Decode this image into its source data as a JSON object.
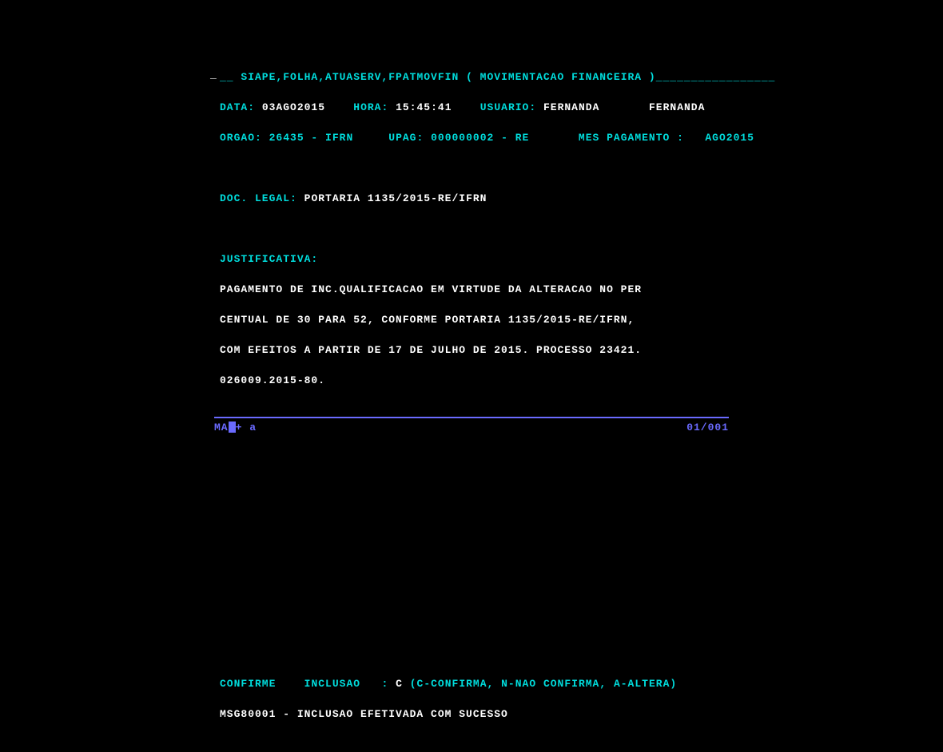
{
  "header": {
    "path": "SIAPE,FOLHA,ATUASERV,FPATMOVFIN",
    "title": "( MOVIMENTACAO FINANCEIRA )"
  },
  "row2": {
    "data_label": "DATA:",
    "data_value": "03AGO2015",
    "hora_label": "HORA:",
    "hora_value": "15:45:41",
    "usuario_label": "USUARIO:",
    "usuario_value": "FERNANDA",
    "usuario_extra": "FERNANDA"
  },
  "row3": {
    "orgao_label": "ORGAO:",
    "orgao_value": "26435 - IFRN",
    "upag_label": "UPAG:",
    "upag_value": "000000002 - RE",
    "mes_label": "MES PAGAMENTO :",
    "mes_value": "AGO2015"
  },
  "doc": {
    "label": "DOC. LEGAL:",
    "value": "PORTARIA 1135/2015-RE/IFRN"
  },
  "justificativa": {
    "label": "JUSTIFICATIVA:",
    "l1": "PAGAMENTO DE INC.QUALIFICACAO EM VIRTUDE DA ALTERACAO NO PER",
    "l2": "CENTUAL DE 30 PARA 52, CONFORME PORTARIA 1135/2015-RE/IFRN,",
    "l3": "COM EFEITOS A PARTIR DE 17 DE JULHO DE 2015. PROCESSO 23421.",
    "l4": "026009.2015-80."
  },
  "confirm": {
    "label1": "CONFIRME",
    "label2": "INCLUSAO",
    "colon": ":",
    "value": "C",
    "hint": "(C-CONFIRMA, N-NAO CONFIRMA, A-ALTERA)"
  },
  "msg": "MSG80001 - INCLUSAO EFETIVADA COM SUCESSO",
  "status": {
    "left_pre": "MA",
    "left_post": "+  a",
    "right": "01/001"
  }
}
